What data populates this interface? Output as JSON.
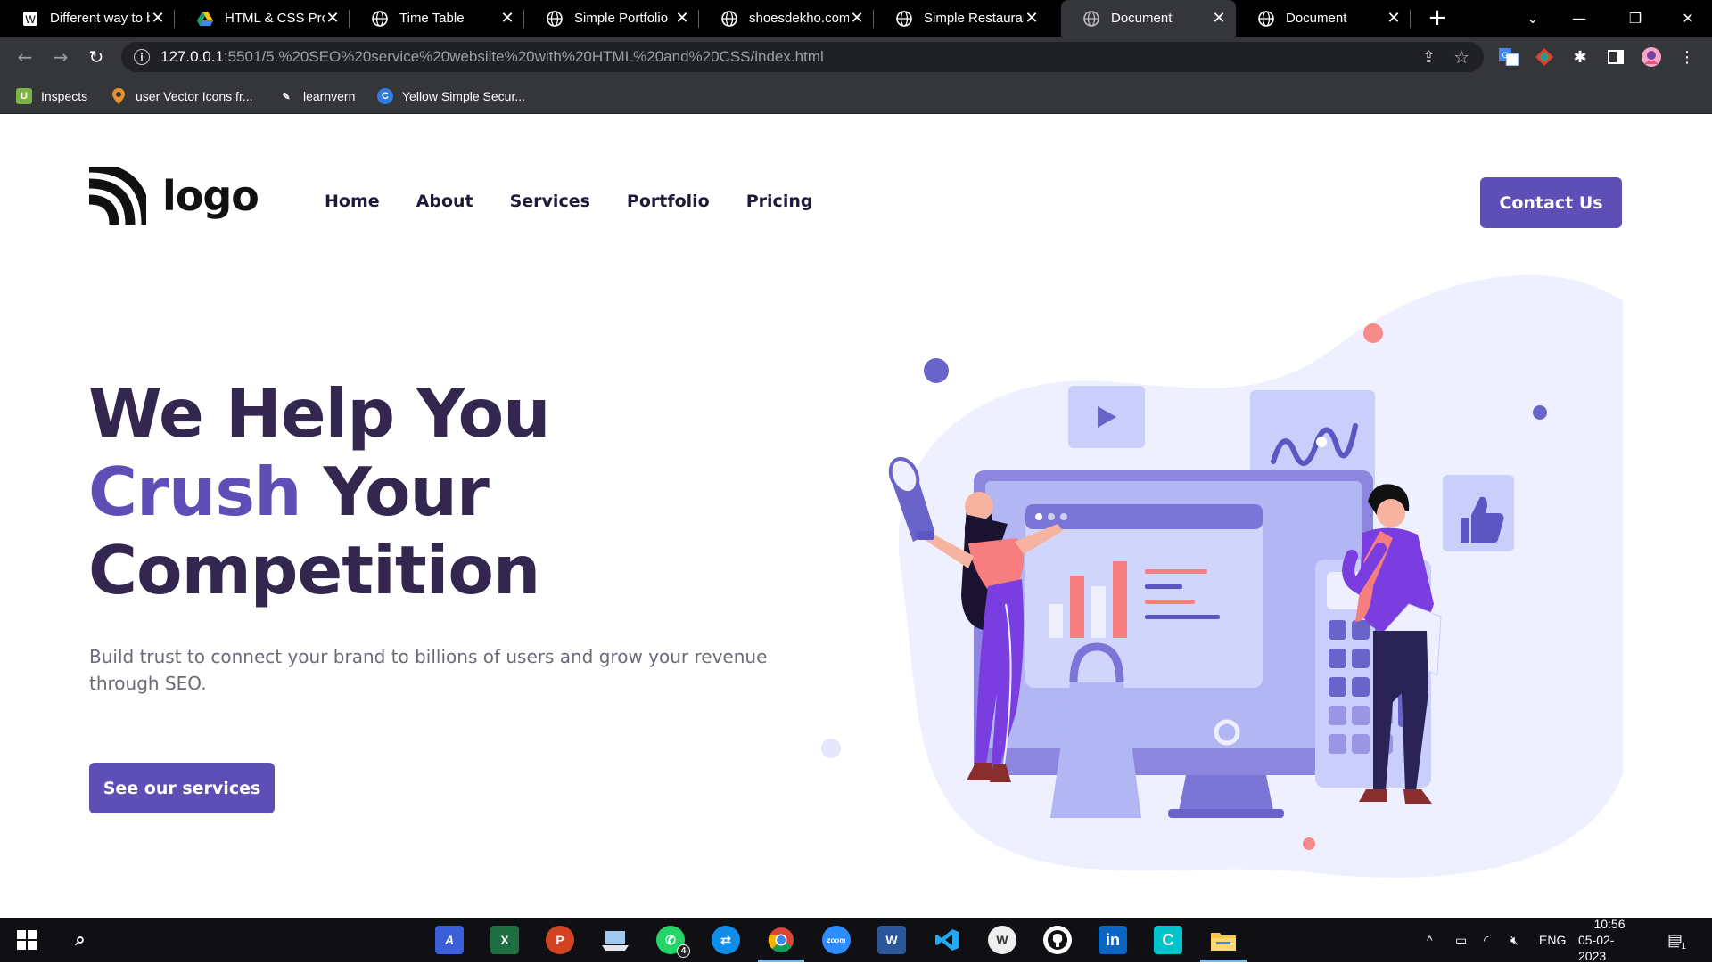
{
  "browser": {
    "tabs": [
      {
        "title": "Different way to b",
        "icon": "wordpress-icon"
      },
      {
        "title": "HTML & CSS Proj",
        "icon": "google-drive-icon"
      },
      {
        "title": "Time Table",
        "icon": "globe-icon"
      },
      {
        "title": "Simple Portfolio",
        "icon": "globe-icon"
      },
      {
        "title": "shoesdekho.com",
        "icon": "globe-icon"
      },
      {
        "title": "Simple Restauran",
        "icon": "globe-icon"
      },
      {
        "title": "Document",
        "icon": "globe-icon",
        "active": true
      },
      {
        "title": "Document",
        "icon": "globe-icon"
      }
    ],
    "url_host": "127.0.0.1",
    "url_path": ":5501/5.%20SEO%20service%20websiite%20with%20HTML%20and%20CSS/index.html",
    "bookmarks": [
      {
        "label": "Inspects"
      },
      {
        "label": "user Vector Icons fr..."
      },
      {
        "label": "learnvern"
      },
      {
        "label": "Yellow Simple Secur..."
      }
    ]
  },
  "site": {
    "logo_text": "logo",
    "nav": [
      "Home",
      "About",
      "Services",
      "Portfolio",
      "Pricing"
    ],
    "contact_label": "Contact Us",
    "hero": {
      "line1": "We Help You",
      "line2_highlight": "Crush",
      "line2_rest": " Your",
      "line3": "Competition",
      "subtitle": "Build trust to connect your brand to billions of users and grow your revenue through SEO.",
      "cta_label": "See our services"
    }
  },
  "colors": {
    "primary": "#5e4fb6",
    "heading": "#33274f",
    "blob": "#eef0ff"
  },
  "taskbar": {
    "apps": [
      "windows-start",
      "search",
      "app-a",
      "excel",
      "powerpoint",
      "laptop-app",
      "whatsapp",
      "teamviewer",
      "chrome",
      "zoom",
      "word",
      "vscode",
      "wordpress",
      "github",
      "linkedin",
      "canva",
      "file-explorer"
    ],
    "whatsapp_badge": "4",
    "lang": "ENG",
    "time": "10:56",
    "date": "05-02-2023",
    "notifications": "1"
  }
}
